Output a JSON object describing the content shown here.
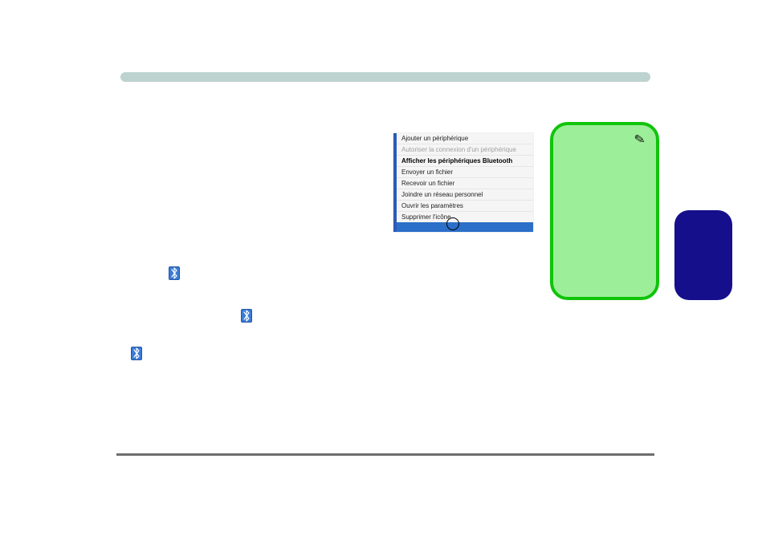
{
  "bluetooth_menu": {
    "items": [
      {
        "label": "Ajouter un périphérique",
        "state": "normal"
      },
      {
        "label": "Autoriser la connexion d'un périphérique",
        "state": "disabled"
      },
      {
        "label": "Afficher les périphériques Bluetooth",
        "state": "bold"
      },
      {
        "label": "Envoyer un fichier",
        "state": "normal"
      },
      {
        "label": "Recevoir un fichier",
        "state": "normal"
      },
      {
        "label": "Joindre un réseau personnel",
        "state": "normal"
      },
      {
        "label": "Ouvrir les paramètres",
        "state": "normal"
      },
      {
        "label": "Supprimer l'icône",
        "state": "normal"
      }
    ]
  },
  "icons": {
    "bluetooth": "bluetooth-icon"
  },
  "colors": {
    "sticky_fill": "#9dee99",
    "sticky_border": "#10c40a",
    "blue_box": "#150f8c",
    "top_bar": "#bcd3cf",
    "menu_accent": "#2b6fc9"
  }
}
